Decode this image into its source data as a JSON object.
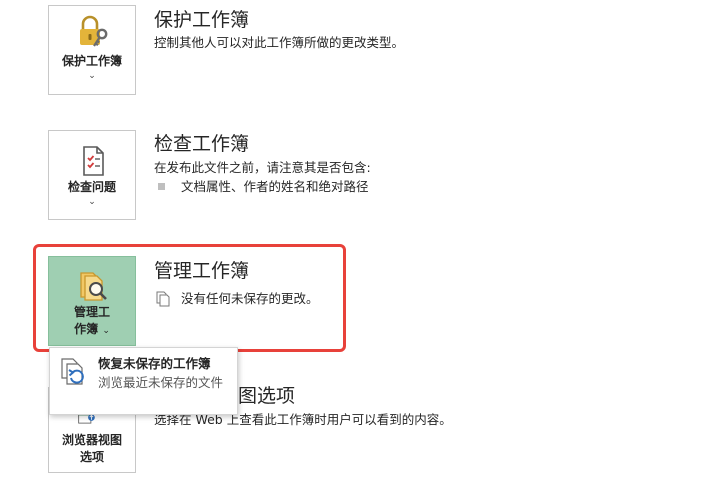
{
  "protect": {
    "tile_label": "保护工作簿",
    "title": "保护工作簿",
    "description": "控制其他人可以对此工作簿所做的更改类型。"
  },
  "inspect": {
    "tile_label": "检查问题",
    "title": "检查工作簿",
    "description": "在发布此文件之前，请注意其是否包含:",
    "bullets": [
      "文档属性、作者的姓名和绝对路径"
    ]
  },
  "manage": {
    "tile_label_line1": "管理工",
    "tile_label_line2": "作簿",
    "title": "管理工作簿",
    "status": "没有任何未保存的更改。",
    "dropdown": {
      "item_title": "恢复未保存的工作簿",
      "item_desc": "浏览最近未保存的文件"
    }
  },
  "browser": {
    "tile_label_line1": "浏览器视图",
    "tile_label_line2": "选项",
    "title_visible": "图选项",
    "description": "选择在 Web 上查看此工作簿时用户可以看到的内容。"
  },
  "chevron_glyph": "⌄",
  "colors": {
    "selected_tile": "#9fcfb2",
    "highlight_border": "#e8413a",
    "lock_gold": "#e3b43a",
    "key_gray": "#6b6b6b",
    "check_red": "#d23b3b",
    "accent_blue": "#2f6fbd"
  },
  "icons": {
    "protect": "lock-key-icon",
    "inspect": "document-check-icon",
    "manage": "document-search-icon",
    "status": "documents-icon",
    "recover": "recover-document-icon",
    "browser": "browser-view-icon"
  }
}
